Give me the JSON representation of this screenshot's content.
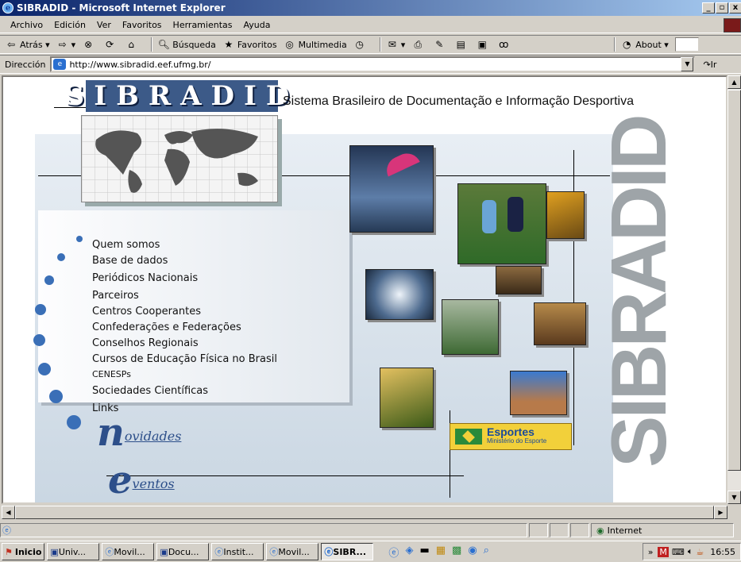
{
  "window": {
    "title": "SIBRADID - Microsoft Internet Explorer"
  },
  "menubar": {
    "items": [
      "Archivo",
      "Edición",
      "Ver",
      "Favoritos",
      "Herramientas",
      "Ayuda"
    ]
  },
  "toolbar": {
    "back": "Atrás",
    "search": "Búsqueda",
    "favorites": "Favoritos",
    "multimedia": "Multimedia",
    "about": "About"
  },
  "address": {
    "label": "Dirección",
    "url": "http://www.sibradid.eef.ufmg.br/",
    "go": "Ir"
  },
  "page": {
    "logo": "SIBRADID",
    "subtitle": "Sistema Brasileiro de Documentação e Informação Desportiva",
    "menu": [
      "Quem somos",
      "Base de dados",
      "Periódicos Nacionais",
      "Parceiros",
      "Centros Cooperantes",
      "Confederações e Federações",
      "Conselhos Regionais",
      "Cursos de Educação Física no Brasil",
      "CENESPs",
      "Sociedades Científicas",
      "Links"
    ],
    "vertical_logo": "SIBRADID",
    "banner_title": "Esportes",
    "banner_sub": "Ministério do Esporte",
    "novidades_initial": "n",
    "novidades_rest": "ovidades",
    "eventos_initial": "e",
    "eventos_rest": "ventos"
  },
  "status": {
    "zone": "Internet"
  },
  "taskbar": {
    "start": "Inicio",
    "buttons": [
      "Univ...",
      "Movil...",
      "Docu...",
      "Instit...",
      "Movil...",
      "SIBR..."
    ],
    "clock": "16:55"
  },
  "colors": {
    "titlebar_start": "#0a246a",
    "logo_bg": "#3c5a88",
    "menu_dot": "#3a6fb7"
  }
}
